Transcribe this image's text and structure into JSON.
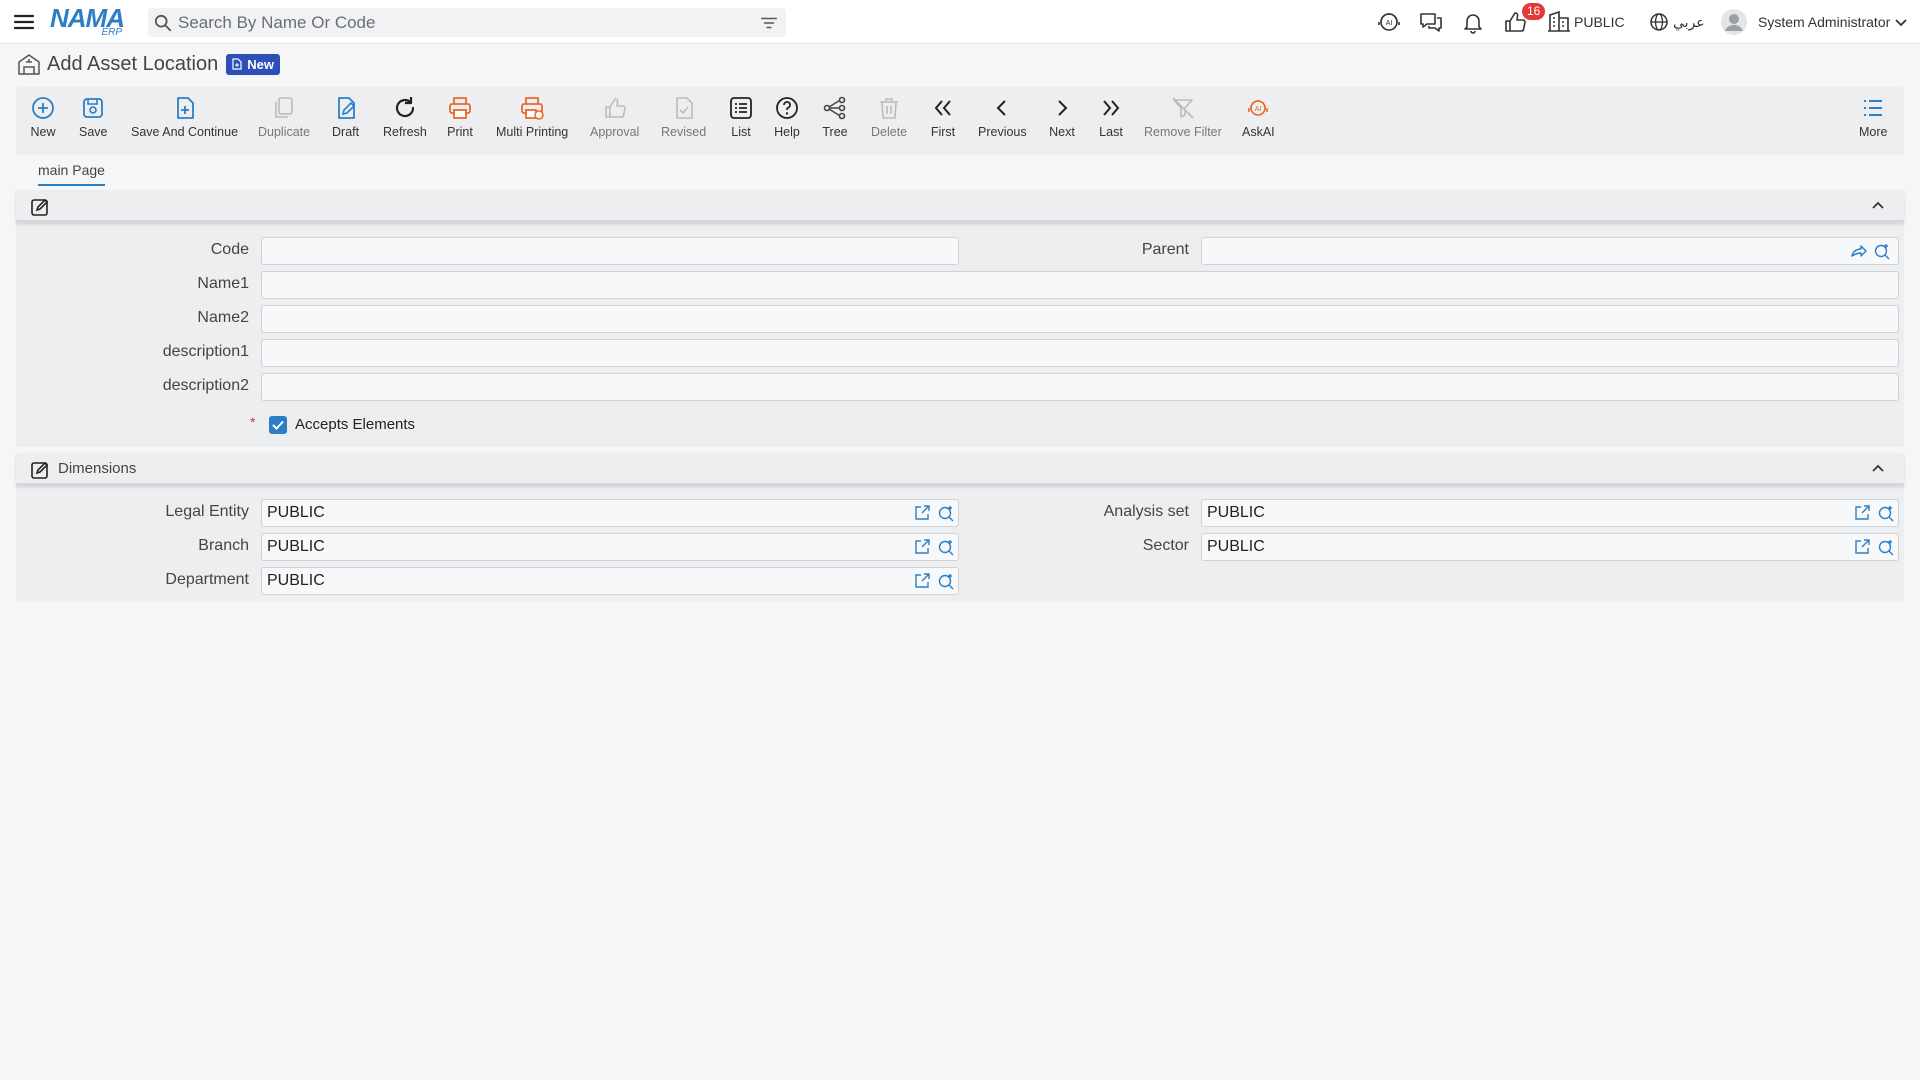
{
  "topbar": {
    "logo_main": "NAMA",
    "logo_sub": "ERP",
    "search_placeholder": "Search By Name Or Code",
    "notification_count": "16",
    "company": "PUBLIC",
    "language": "عربي",
    "user": "System Administrator"
  },
  "page": {
    "title": "Add Asset Location",
    "status_badge": "New"
  },
  "toolbar": {
    "new": "New",
    "save": "Save",
    "save_continue": "Save And Continue",
    "duplicate": "Duplicate",
    "draft": "Draft",
    "refresh": "Refresh",
    "print": "Print",
    "multi_printing": "Multi Printing",
    "approval": "Approval",
    "revised": "Revised",
    "list": "List",
    "help": "Help",
    "tree": "Tree",
    "delete": "Delete",
    "first": "First",
    "previous": "Previous",
    "next": "Next",
    "last": "Last",
    "remove_filter": "Remove Filter",
    "askai": "AskAI",
    "more": "More"
  },
  "tabs": {
    "main": "main Page"
  },
  "main_section": {
    "code_label": "Code",
    "code_value": "",
    "parent_label": "Parent",
    "parent_value": "",
    "name1_label": "Name1",
    "name1_value": "",
    "name2_label": "Name2",
    "name2_value": "",
    "desc1_label": "description1",
    "desc1_value": "",
    "desc2_label": "description2",
    "desc2_value": "",
    "required_mark": "*",
    "accepts_elements_label": "Accepts Elements",
    "accepts_elements_checked": true
  },
  "dimensions": {
    "title": "Dimensions",
    "legal_entity_label": "Legal Entity",
    "legal_entity_value": "PUBLIC",
    "analysis_set_label": "Analysis set",
    "analysis_set_value": "PUBLIC",
    "branch_label": "Branch",
    "branch_value": "PUBLIC",
    "sector_label": "Sector",
    "sector_value": "PUBLIC",
    "department_label": "Department",
    "department_value": "PUBLIC"
  },
  "colors": {
    "accent": "#2c7fc6",
    "print_orange": "#e8692a",
    "badge_red": "#e53935",
    "new_badge": "#2d4fb8"
  }
}
